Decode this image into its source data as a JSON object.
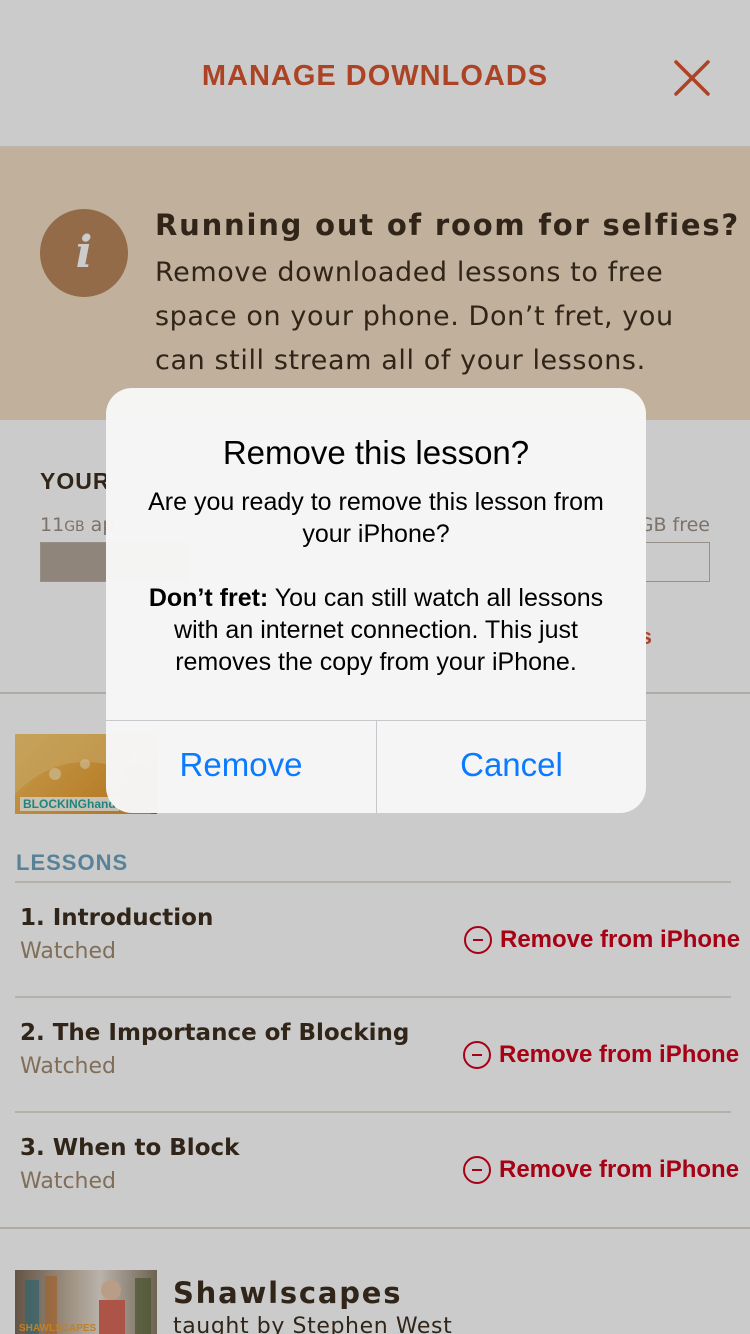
{
  "header": {
    "title": "MANAGE DOWNLOADS",
    "close_icon": "close-icon",
    "accent_color": "#d9542f"
  },
  "info_banner": {
    "icon": "info-icon",
    "icon_glyph": "i",
    "heading": "Running out of room for selfies?",
    "body_lines": [
      "Remove downloaded lessons to free",
      "space on your phone. Don’t fret, you",
      "can still stream all of your lessons."
    ]
  },
  "storage": {
    "title": "YOUR",
    "used_size": "11",
    "used_unit": "GB",
    "used_suffix": " ap",
    "free_label": "GB free",
    "fill_fraction": 0.22,
    "link_tail": "s"
  },
  "course": {
    "thumbnail_label": "BLOCKINGhand"
  },
  "lessons": {
    "section_label": "LESSONS",
    "remove_icon": "minus-circle-icon",
    "remove_label": "Remove from iPhone",
    "items": [
      {
        "title": "1. Introduction",
        "status": "Watched"
      },
      {
        "title": "2. The Importance of Blocking",
        "status": "Watched"
      },
      {
        "title": "3. When to Block",
        "status": "Watched"
      }
    ]
  },
  "next_course": {
    "thumbnail_label": "SHAWLSCAPES",
    "title": "Shawlscapes",
    "subtitle": "taught by Stephen West"
  },
  "alert": {
    "title": "Remove this lesson?",
    "message": "Are you ready to remove this lesson from your iPhone?",
    "note_bold": "Don’t fret:",
    "note_text": " You can still watch all lessons with an internet connection. This just removes the copy from your iPhone.",
    "primary_button": "Remove",
    "secondary_button": "Cancel",
    "button_color": "#0a7aff"
  }
}
